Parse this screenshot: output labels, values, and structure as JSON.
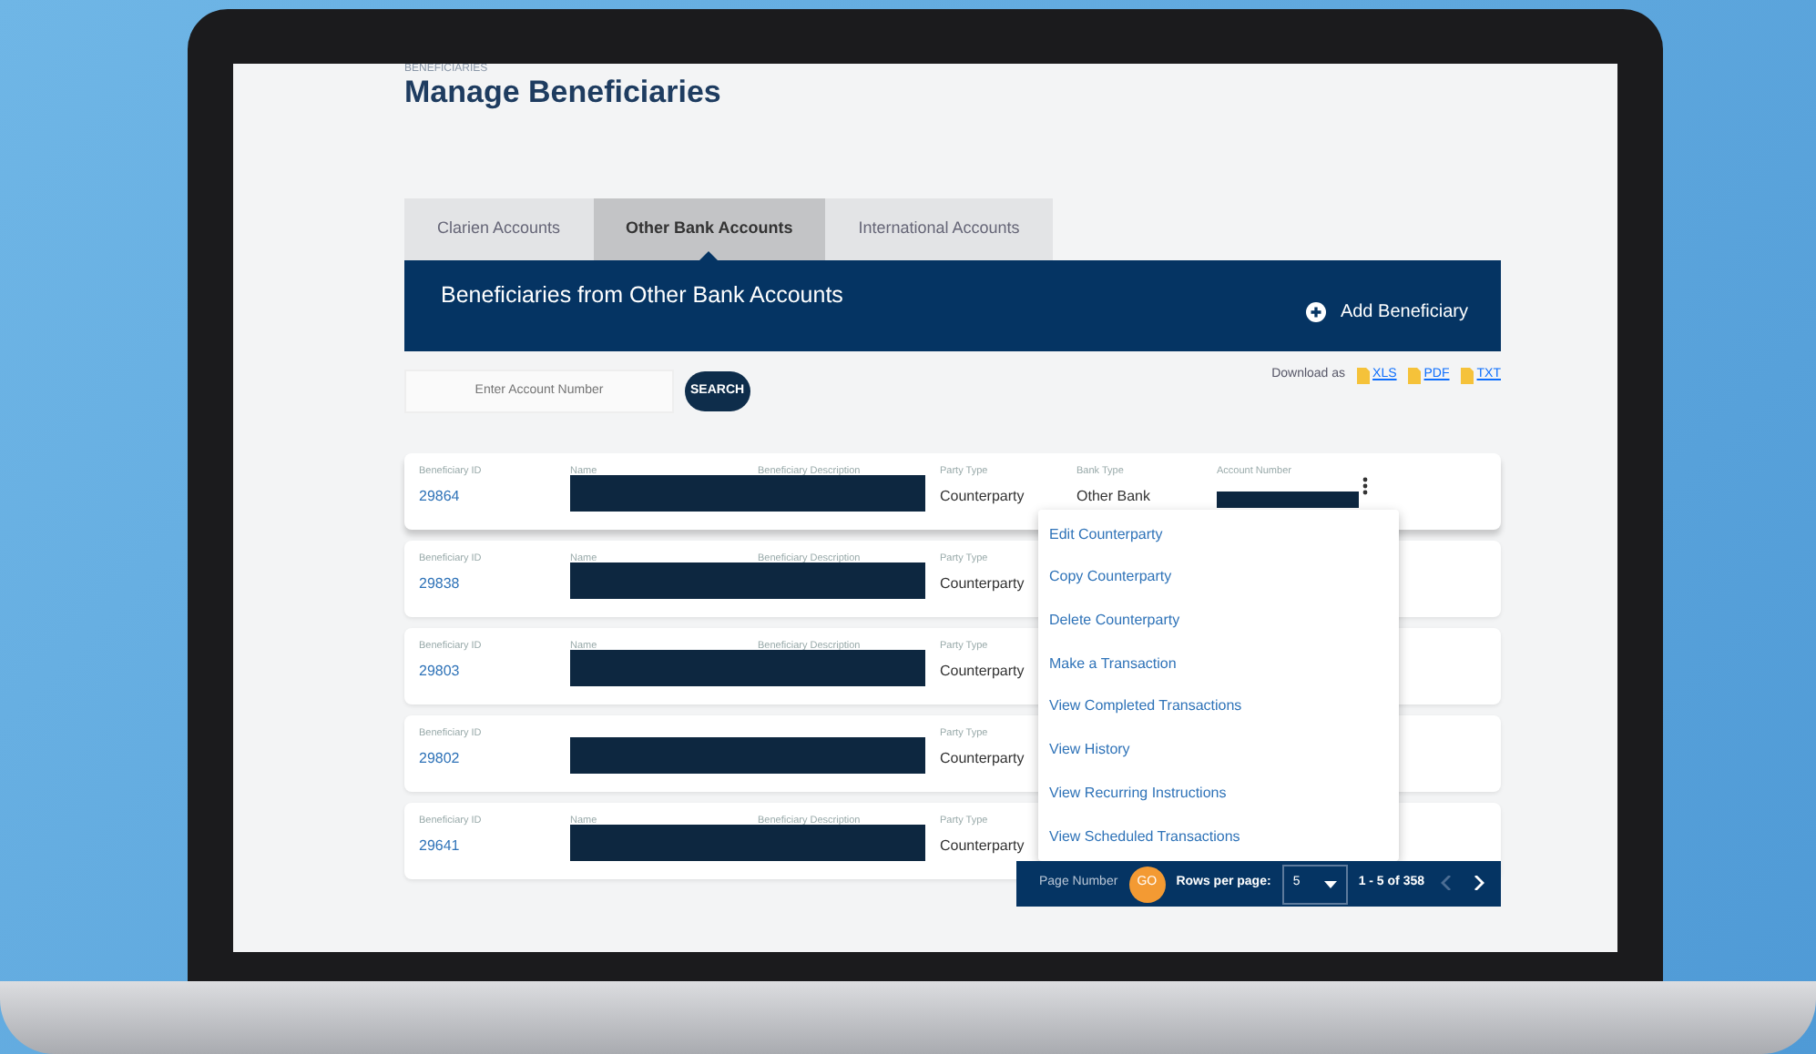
{
  "breadcrumb": "BENEFICIARIES",
  "title": "Manage Beneficiaries",
  "tabs": [
    {
      "label": "Clarien Accounts",
      "selected": false
    },
    {
      "label": "Other Bank Accounts",
      "selected": true
    },
    {
      "label": "International Accounts",
      "selected": false
    }
  ],
  "panel": {
    "title": "Beneficiaries from Other Bank Accounts",
    "add_button": "Add Beneficiary"
  },
  "search": {
    "placeholder": "Enter Account Number",
    "button": "SEARCH"
  },
  "download": {
    "label": "Download as",
    "formats": [
      "XLS",
      "PDF",
      "TXT"
    ]
  },
  "rows": [
    {
      "id_label": "Beneficiary ID",
      "id": "29864",
      "name_label": "Name",
      "description_label": "Beneficiary Description",
      "party_type_label": "Party Type",
      "party_type": "Counterparty",
      "bank_type_label": "Bank Type",
      "bank_type": "Other Bank",
      "account_number_label": "Account Number",
      "menu_open": true
    },
    {
      "id_label": "Beneficiary ID",
      "id": "29838",
      "name_label": "Name",
      "description_label": "Beneficiary Description",
      "party_type_label": "Party Type",
      "party_type": "Counterparty"
    },
    {
      "id_label": "Beneficiary ID",
      "id": "29803",
      "name_label": "Name",
      "description_label": "Beneficiary Description",
      "party_type_label": "Party Type",
      "party_type": "Counterparty"
    },
    {
      "id_label": "Beneficiary ID",
      "id": "29802",
      "party_type_label": "Party Type",
      "party_type": "Counterparty"
    },
    {
      "id_label": "Beneficiary ID",
      "id": "29641",
      "name_label": "Name",
      "description_label": "Beneficiary Description",
      "party_type_label": "Party Type",
      "party_type": "Counterparty"
    }
  ],
  "menu": {
    "items": [
      "Edit Counterparty",
      "Copy Counterparty",
      "Delete Counterparty",
      "Make a Transaction",
      "View Completed Transactions",
      "View History",
      "View Recurring Instructions",
      "View Scheduled Transactions"
    ]
  },
  "pagination": {
    "page_label": "Page Number",
    "go": "GO",
    "rows_label": "Rows per page:",
    "rows_value": "5",
    "range": "1 - 5 of 358",
    "prev_disabled": true,
    "next_disabled": false
  }
}
